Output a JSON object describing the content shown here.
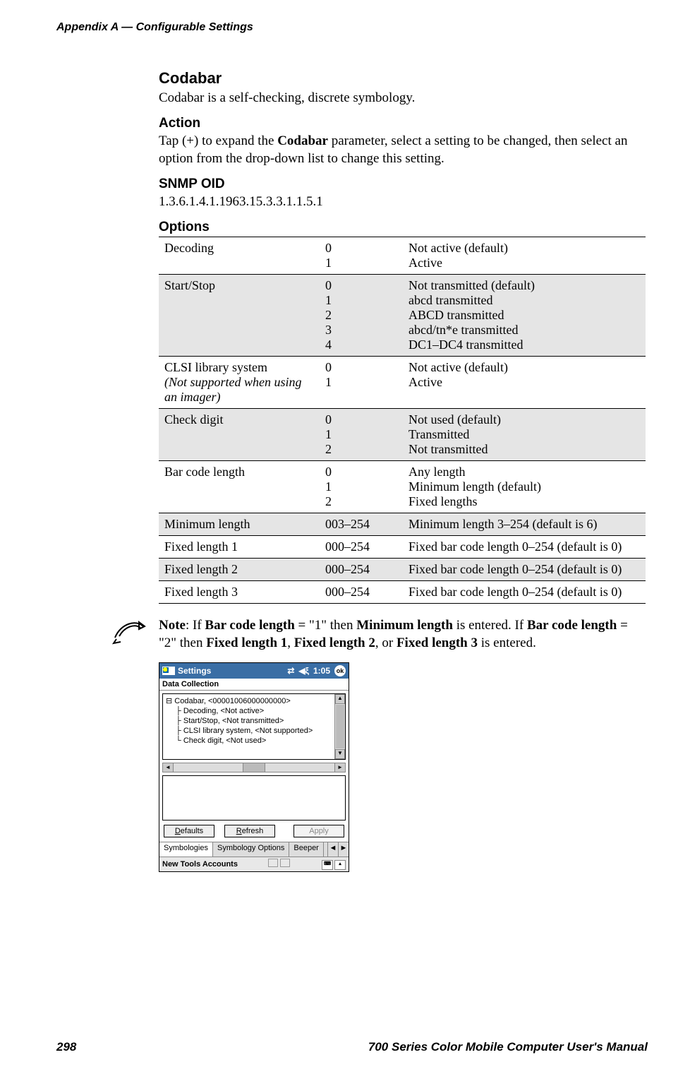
{
  "header": {
    "running": "Appendix A — Configurable Settings"
  },
  "section": {
    "title": "Codabar",
    "intro": "Codabar is a self-checking, discrete symbology.",
    "action_head": "Action",
    "action_body_1": "Tap (+) to expand the ",
    "action_bold": "Codabar",
    "action_body_2": " parameter, select a setting to be changed, then select an option from the drop-down list to change this setting.",
    "snmp_head": "SNMP OID",
    "snmp_value": "1.3.6.1.4.1.1963.15.3.3.1.1.5.1",
    "options_head": "Options"
  },
  "options_rows": [
    {
      "name": "Decoding",
      "italic": "",
      "codes": "0\n1",
      "desc": "Not active (default)\nActive",
      "shaded": false
    },
    {
      "name": "Start/Stop",
      "italic": "",
      "codes": "0\n1\n2\n3\n4",
      "desc": "Not transmitted (default)\nabcd transmitted\nABCD transmitted\nabcd/tn*e transmitted\nDC1–DC4 transmitted",
      "shaded": true
    },
    {
      "name": "CLSI library system",
      "italic": "(Not supported when using an imager)",
      "codes": "0\n1",
      "desc": "Not active (default)\nActive",
      "shaded": false
    },
    {
      "name": "Check digit",
      "italic": "",
      "codes": "0\n1\n2",
      "desc": "Not used (default)\nTransmitted\nNot transmitted",
      "shaded": true
    },
    {
      "name": "Bar code length",
      "italic": "",
      "codes": "0\n1\n2",
      "desc": "Any length\nMinimum length (default)\nFixed lengths",
      "shaded": false
    },
    {
      "name": "Minimum length",
      "italic": "",
      "codes": "003–254",
      "desc": "Minimum length 3–254 (default is 6)",
      "shaded": true
    },
    {
      "name": "Fixed length 1",
      "italic": "",
      "codes": "000–254",
      "desc": "Fixed bar code length 0–254 (default is 0)",
      "shaded": false
    },
    {
      "name": "Fixed length 2",
      "italic": "",
      "codes": "000–254",
      "desc": "Fixed bar code length 0–254 (default is 0)",
      "shaded": true
    },
    {
      "name": "Fixed length 3",
      "italic": "",
      "codes": "000–254",
      "desc": "Fixed bar code length 0–254 (default is 0)",
      "shaded": false
    }
  ],
  "note": {
    "prefix": "Note",
    "t1": ": If ",
    "b1": "Bar code length",
    "t2": " = \"1\" then ",
    "b2": "Minimum length",
    "t3": " is entered. If ",
    "b3": "Bar code length",
    "t4": " = \"2\" then ",
    "b4": "Fixed length 1",
    "t5": ", ",
    "b5": "Fixed length 2",
    "t6": ", or ",
    "b6": "Fixed length 3",
    "t7": " is entered."
  },
  "screenshot": {
    "title": "Settings",
    "clock": "1:05",
    "ok": "ok",
    "panel_title": "Data Collection",
    "tree": {
      "root": "Codabar, <00001006000000000>",
      "items": [
        "Decoding, <Not active>",
        "Start/Stop, <Not transmitted>",
        "CLSI library system, <Not supported>",
        "Check digit, <Not used>"
      ]
    },
    "buttons": {
      "defaults": "Defaults",
      "refresh": "Refresh",
      "apply": "Apply"
    },
    "tabs": {
      "t1": "Symbologies",
      "t2": "Symbology Options",
      "t3": "Beeper"
    },
    "footer": "New Tools Accounts"
  },
  "footer": {
    "page": "298",
    "title": "700 Series Color Mobile Computer User's Manual"
  }
}
